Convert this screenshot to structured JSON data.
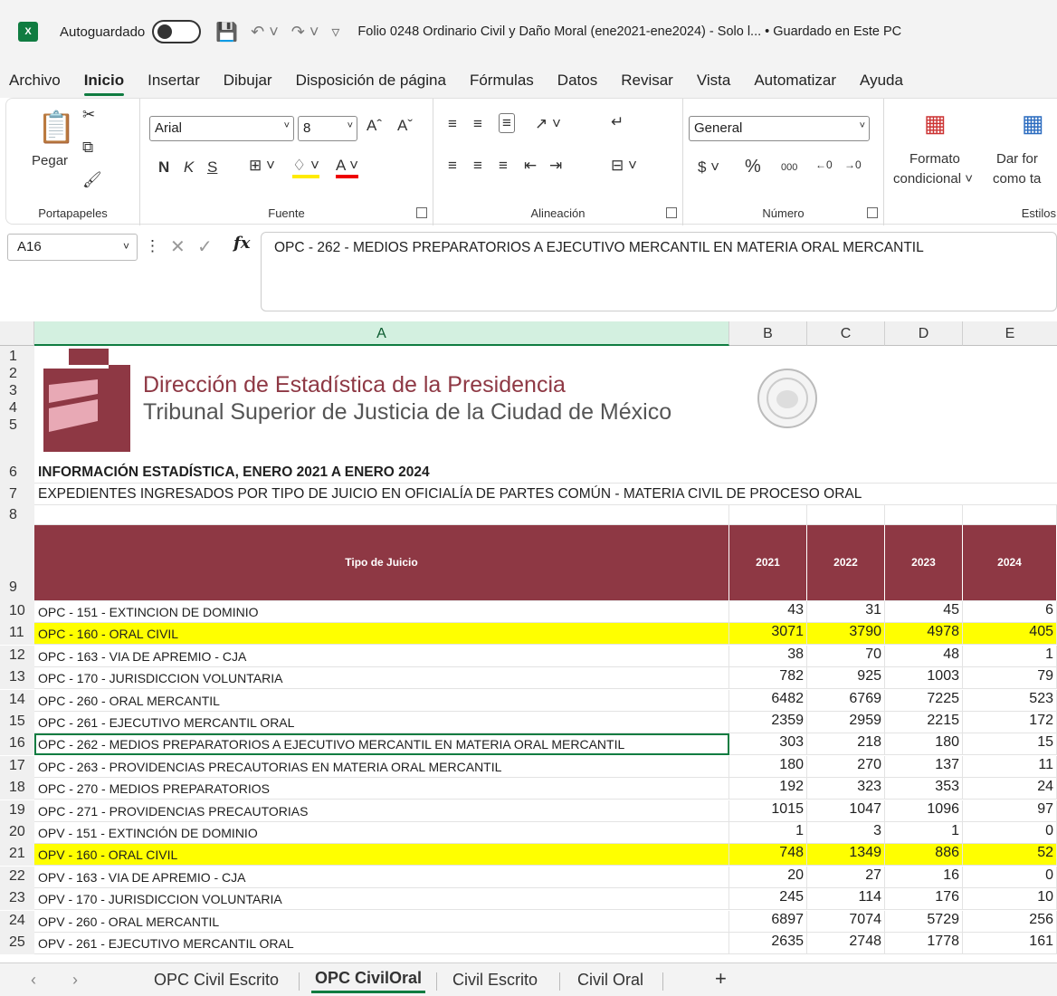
{
  "app": {
    "autosave_label": "Autoguardado",
    "doc_title": "Folio 0248 Ordinario Civil y Daño Moral (ene2021-ene2024)  -  Solo l...  • Guardado en Este PC"
  },
  "menu": [
    "Archivo",
    "Inicio",
    "Insertar",
    "Dibujar",
    "Disposición de página",
    "Fórmulas",
    "Datos",
    "Revisar",
    "Vista",
    "Automatizar",
    "Ayuda"
  ],
  "ribbon": {
    "paste_label": "Pegar",
    "font_name": "Arial",
    "font_size": "8",
    "number_format": "General",
    "cond_format_label_1": "Formato",
    "cond_format_label_2": "condicional ˅",
    "table_format_label_1": "Dar for",
    "table_format_label_2": "como ta",
    "groups": {
      "clipboard": "Portapapeles",
      "font": "Fuente",
      "alignment": "Alineación",
      "number": "Número",
      "styles": "Estilos"
    },
    "bold": "N",
    "italic": "K",
    "underline": "S"
  },
  "formula": {
    "name_box": "A16",
    "content": "OPC - 262 - MEDIOS PREPARATORIOS A EJECUTIVO MERCANTIL EN MATERIA ORAL MERCANTIL"
  },
  "columns": [
    "A",
    "B",
    "C",
    "D",
    "E"
  ],
  "sheet": {
    "org_line1": "Dirección de Estadística de la Presidencia",
    "org_line2": "Tribunal Superior de Justicia de la Ciudad de México",
    "title": "INFORMACIÓN ESTADÍSTICA, ENERO 2021 A ENERO 2024",
    "subtitle": "EXPEDIENTES INGRESADOS POR TIPO DE JUICIO EN OFICIALÍA DE PARTES COMÚN - MATERIA CIVIL DE PROCESO ORAL",
    "header": [
      "Tipo de Juicio",
      "2021",
      "2022",
      "2023",
      "2024"
    ],
    "rows": [
      {
        "n": "10",
        "label": "OPC - 151 - EXTINCION DE DOMINIO",
        "v": [
          "43",
          "31",
          "45",
          "6"
        ],
        "hl": false
      },
      {
        "n": "11",
        "label": "OPC - 160 - ORAL CIVIL",
        "v": [
          "3071",
          "3790",
          "4978",
          "405"
        ],
        "hl": true
      },
      {
        "n": "12",
        "label": "OPC - 163 - VIA DE APREMIO - CJA",
        "v": [
          "38",
          "70",
          "48",
          "1"
        ],
        "hl": false
      },
      {
        "n": "13",
        "label": "OPC - 170 - JURISDICCION VOLUNTARIA",
        "v": [
          "782",
          "925",
          "1003",
          "79"
        ],
        "hl": false
      },
      {
        "n": "14",
        "label": "OPC - 260 - ORAL MERCANTIL",
        "v": [
          "6482",
          "6769",
          "7225",
          "523"
        ],
        "hl": false
      },
      {
        "n": "15",
        "label": "OPC - 261 - EJECUTIVO MERCANTIL ORAL",
        "v": [
          "2359",
          "2959",
          "2215",
          "172"
        ],
        "hl": false
      },
      {
        "n": "16",
        "label": "OPC - 262 - MEDIOS PREPARATORIOS A EJECUTIVO MERCANTIL EN MATERIA ORAL MERCANTIL",
        "v": [
          "303",
          "218",
          "180",
          "15"
        ],
        "hl": false
      },
      {
        "n": "17",
        "label": "OPC - 263 - PROVIDENCIAS PRECAUTORIAS EN MATERIA ORAL MERCANTIL",
        "v": [
          "180",
          "270",
          "137",
          "11"
        ],
        "hl": false
      },
      {
        "n": "18",
        "label": "OPC - 270 - MEDIOS PREPARATORIOS",
        "v": [
          "192",
          "323",
          "353",
          "24"
        ],
        "hl": false
      },
      {
        "n": "19",
        "label": "OPC - 271 - PROVIDENCIAS PRECAUTORIAS",
        "v": [
          "1015",
          "1047",
          "1096",
          "97"
        ],
        "hl": false
      },
      {
        "n": "20",
        "label": "OPV - 151 - EXTINCIÓN DE DOMINIO",
        "v": [
          "1",
          "3",
          "1",
          "0"
        ],
        "hl": false
      },
      {
        "n": "21",
        "label": "OPV - 160 - ORAL CIVIL",
        "v": [
          "748",
          "1349",
          "886",
          "52"
        ],
        "hl": true
      },
      {
        "n": "22",
        "label": "OPV - 163 - VIA DE APREMIO - CJA",
        "v": [
          "20",
          "27",
          "16",
          "0"
        ],
        "hl": false
      },
      {
        "n": "23",
        "label": "OPV - 170 - JURISDICCION VOLUNTARIA",
        "v": [
          "245",
          "114",
          "176",
          "10"
        ],
        "hl": false
      },
      {
        "n": "24",
        "label": "OPV - 260 - ORAL MERCANTIL",
        "v": [
          "6897",
          "7074",
          "5729",
          "256"
        ],
        "hl": false
      },
      {
        "n": "25",
        "label": "OPV - 261 - EJECUTIVO MERCANTIL ORAL",
        "v": [
          "2635",
          "2748",
          "1778",
          "161"
        ],
        "hl": false
      }
    ]
  },
  "tabs": [
    "OPC Civil Escrito",
    "OPC CivilOral",
    "Civil Escrito",
    "Civil Oral"
  ],
  "colors": {
    "header_bg": "#8e3844",
    "highlight": "#ffff00",
    "accent": "#107c41"
  }
}
